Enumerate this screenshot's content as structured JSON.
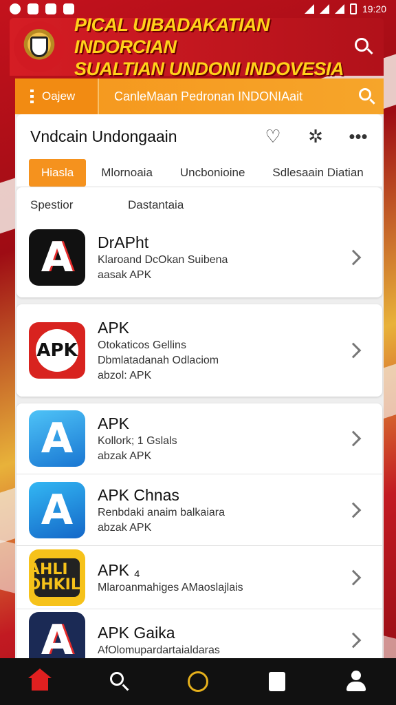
{
  "status_bar": {
    "time": "19:20"
  },
  "header": {
    "title_line1": "PICAL UIBADAKATIAN INDORCIAN",
    "title_line2": "SUALTIAN UNDONI INDOVESIA",
    "emblem_icon": "garuda-emblem-icon",
    "search_icon": "search-icon"
  },
  "nav": {
    "menu_label": "Oajew",
    "subtitle": "CanleMaan  Pedronan INDONIAait",
    "search_icon": "search-icon"
  },
  "page": {
    "title": "Vndcain Undongaain",
    "icons": [
      "heart-icon",
      "puzzle-icon",
      "more-icon"
    ]
  },
  "tabs": [
    {
      "label": "Hiasla",
      "active": true
    },
    {
      "label": "Mlornoaia",
      "active": false
    },
    {
      "label": "Uncbonioine",
      "active": false
    },
    {
      "label": "Sdlesaain Diatian",
      "active": false
    }
  ],
  "section": {
    "col1": "Spestior",
    "col2": "Dastantaia"
  },
  "apps": [
    {
      "name": "DrAPht",
      "line1": "Klaroand DcOkan Suibena",
      "line2": "aasak APK"
    },
    {
      "name": "APK",
      "line1": "Otokaticos Gellins",
      "line2": "Dbmlatadanah Odlaciom",
      "line3": "abzol: APK",
      "badge": "APK"
    },
    {
      "name": "APK",
      "line1": "Kollork; 1 Gslals",
      "line2": "abzak APK"
    },
    {
      "name": "APK Chnas",
      "line1": "Renbdaki anaim balkaiara",
      "line2": "abzak APK"
    },
    {
      "name": "APK ₄",
      "line1": "Mlaroanmahiges AMaoslajlais",
      "badge": "AHLI DHKILI"
    },
    {
      "name": "APK Gaika",
      "line1": "AfOlomupardartaialdaras"
    }
  ],
  "colors": {
    "brand_red": "#d51d24",
    "accent_orange": "#f5961c",
    "banner_text": "#ffd21a"
  },
  "bottom_nav": [
    "home-icon",
    "search-icon",
    "circle-icon",
    "document-icon",
    "profile-icon"
  ]
}
